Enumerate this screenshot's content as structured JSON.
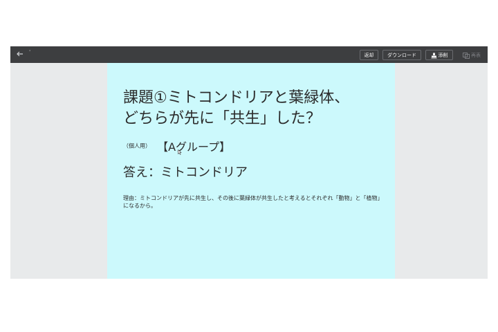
{
  "toolbar": {
    "back_icon": "arrow-left-icon",
    "tick": "'",
    "return_label": "返却",
    "download_label": "ダウンロード",
    "correct_label": "添削",
    "correct_icon": "stamp-icon",
    "submit_label": "再表",
    "submit_icon": "copy-icon"
  },
  "slide": {
    "background": "#ccf9fc",
    "title_line1": "課題①ミトコンドリアと葉緑体、",
    "title_line2": "どちらが先に「共生」した？",
    "individual_note": "（個人用）",
    "group_label": "【Aグループ】",
    "answer": "答え：ミトコンドリア",
    "reason": "理由：ミトコンドリアが先に共生し、その後に葉緑体が共生したと考えるとそれぞれ「動物」と「植物」になるから。"
  }
}
